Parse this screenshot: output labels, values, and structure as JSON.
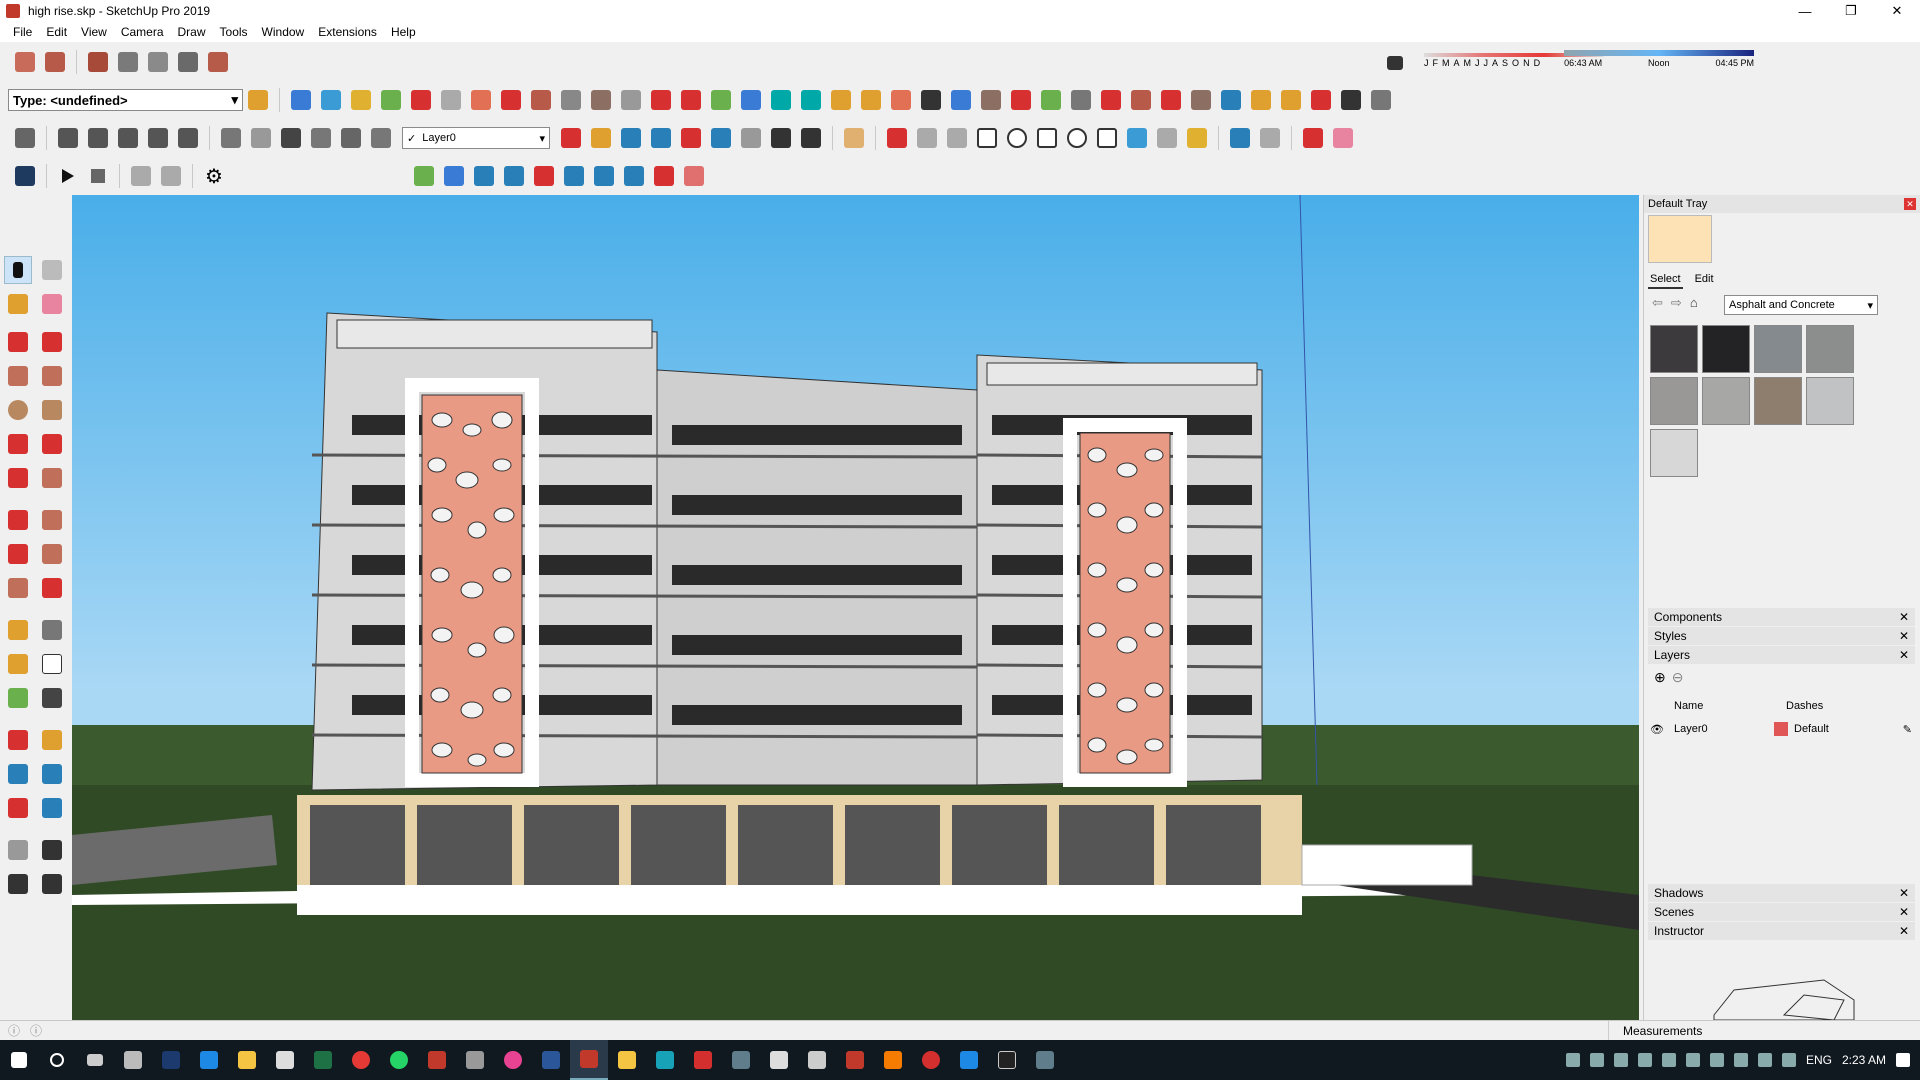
{
  "window": {
    "title": "high rise.skp - SketchUp Pro 2019",
    "controls": [
      "—",
      "❐",
      "✕"
    ]
  },
  "menu": [
    "File",
    "Edit",
    "View",
    "Camera",
    "Draw",
    "Tools",
    "Window",
    "Extensions",
    "Help"
  ],
  "toolbar": {
    "type_label": "Type: <undefined>",
    "layer_select": "Layer0",
    "layer_check": "✓"
  },
  "shadow": {
    "months": [
      "J",
      "F",
      "M",
      "A",
      "M",
      "J",
      "J",
      "A",
      "S",
      "O",
      "N",
      "D"
    ],
    "time_start": "06:43 AM",
    "time_mid": "Noon",
    "time_end": "04:45 PM"
  },
  "tray": {
    "title": "Default Tray",
    "tab_select": "Select",
    "tab_edit": "Edit",
    "library": "Asphalt and Concrete",
    "swatch_colors": [
      "#3c3a3c",
      "#232325",
      "#858a8f",
      "#8c8e8e",
      "#9a9797",
      "#a7a8a6",
      "#8d7e6d",
      "#c0c2c4",
      "#d7d7d7"
    ],
    "panels": {
      "components": "Components",
      "styles": "Styles",
      "layers": "Layers",
      "shadows": "Shadows",
      "scenes": "Scenes",
      "instructor": "Instructor"
    },
    "layers_table": {
      "col_name": "Name",
      "col_dashes": "Dashes",
      "row_name": "Layer0",
      "row_dashes": "Default"
    }
  },
  "status": {
    "measurements_label": "Measurements"
  },
  "taskbar": {
    "lang": "ENG",
    "time": "2:23 AM"
  }
}
